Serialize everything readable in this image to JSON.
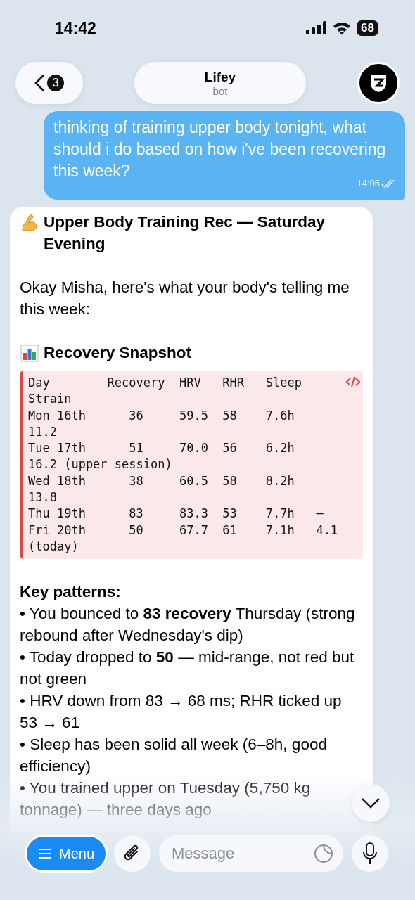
{
  "status_bar": {
    "time": "14:42",
    "battery": "68"
  },
  "header": {
    "back_badge": "3",
    "title": "Lifey",
    "subtitle": "bot"
  },
  "messages": [
    {
      "kind": "outgoing",
      "text": "thinking of training upper body tonight, what should i do based on how i've been recovering this week?",
      "time": "14:05",
      "read": true
    },
    {
      "kind": "incoming",
      "blocks": [
        {
          "kind": "title",
          "text": "Upper Body Training Rec — Saturday Evening"
        },
        {
          "kind": "paragraph",
          "text": "Okay Misha, here's what your body's telling me this week:"
        },
        {
          "kind": "title",
          "text": "Recovery Snapshot"
        },
        {
          "kind": "code",
          "lines": [
            "Day        Recovery  HRV   RHR   Sleep  Strain",
            "Mon 16th      36     59.5  58    7.6h   11.2",
            "Tue 17th      51     70.0  56    6.2h   16.2 (upper session)",
            "Wed 18th      38     60.5  58    8.2h   13.8",
            "Thu 19th      83     83.3  53    7.7h   —",
            "Fri 20th      50     67.7  61    7.1h   4.1 (today)"
          ]
        },
        {
          "kind": "heading",
          "text": "Key patterns:"
        },
        {
          "kind": "bullet",
          "text": "• You bounced to **83 recovery** Thursday (strong rebound after Wednesday's dip)"
        },
        {
          "kind": "bullet",
          "text": "• Today dropped to **50** — mid-range, not red but not green"
        },
        {
          "kind": "bullet",
          "text": "• HRV down from 83 → 68 ms; RHR ticked up 53 → 61"
        },
        {
          "kind": "bullet",
          "text": "• Sleep has been solid all week (6–8h, good efficiency)"
        },
        {
          "kind": "bullet",
          "text": "• You trained upper on Tuesday (5,750 kg tonnage) — three days ago"
        }
      ]
    }
  ],
  "composer": {
    "menu_label": "Menu",
    "placeholder": "Message"
  }
}
